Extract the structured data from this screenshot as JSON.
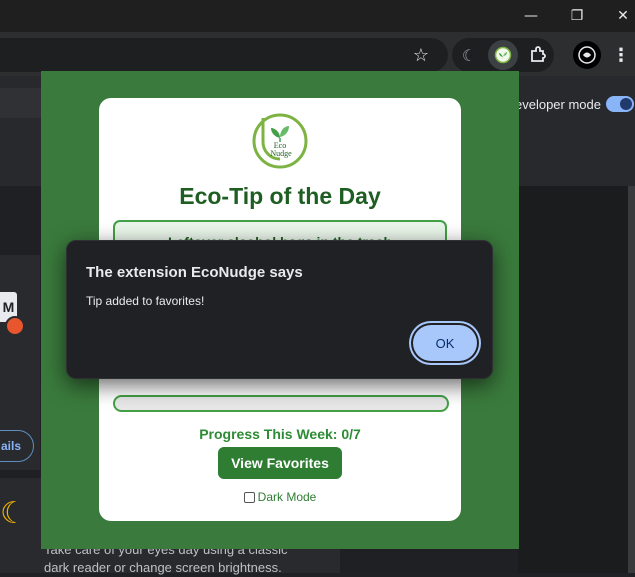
{
  "browser": {
    "window_controls": {
      "minimize": "—",
      "restore": "❐",
      "close": "✕"
    },
    "icons": [
      "star-icon",
      "moon-icon",
      "econudge-icon",
      "puzzle-icon",
      "profile-icon",
      "menu-icon"
    ]
  },
  "background_page": {
    "developer_mode_label": "eveloper mode",
    "developer_mode_on": true,
    "m_button": "M",
    "details_button": "ails",
    "description": "Take care of your eyes day using a classic dark reader or change screen brightness."
  },
  "popup": {
    "logo_text_line1": "Eco",
    "logo_text_line2": "Nudge",
    "title": "Eco-Tip of the Day",
    "tip_text": "Leftover alcohol bags in the trash",
    "progress_fraction": 0,
    "progress_label": "Progress This Week: 0/7",
    "view_favorites_label": "View Favorites",
    "dark_mode_label": "Dark Mode",
    "dark_mode_checked": false
  },
  "dialog": {
    "title": "The extension EcoNudge says",
    "message": "Tip added to favorites!",
    "ok_label": "OK"
  },
  "colors": {
    "popup_bg": "#3a7a3c",
    "title_green": "#1e5e22",
    "button_green": "#2e7d32",
    "ok_blue": "#a8c7fa"
  }
}
